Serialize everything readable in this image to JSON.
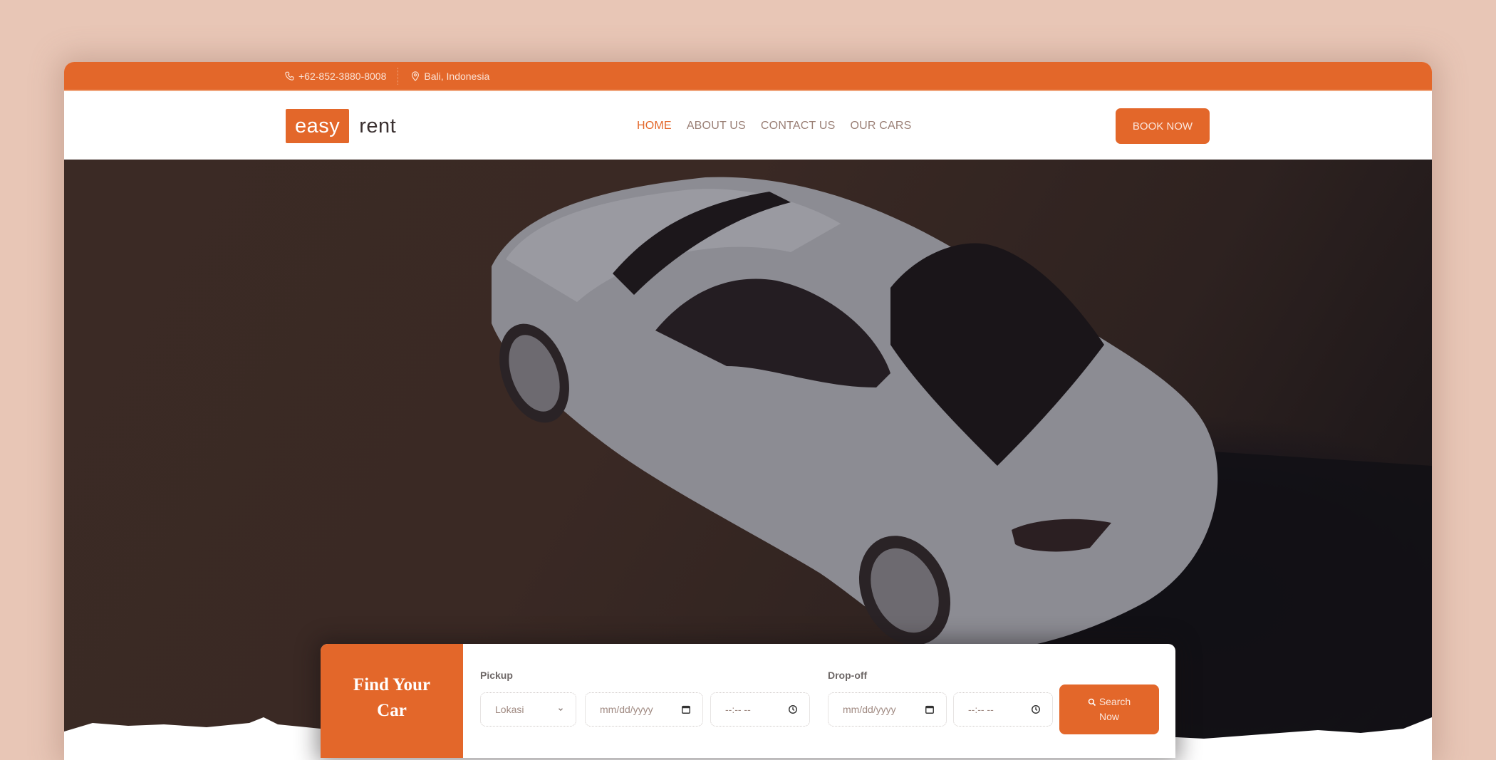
{
  "topbar": {
    "phone": "+62-852-3880-8008",
    "location": "Bali, Indonesia",
    "icons": {
      "phone": "phone-icon",
      "location": "map-pin-icon"
    }
  },
  "brand": {
    "part1": "easy",
    "part2": "rent"
  },
  "nav": {
    "items": [
      {
        "label": "HOME",
        "active": true
      },
      {
        "label": "ABOUT US",
        "active": false
      },
      {
        "label": "CONTACT US",
        "active": false
      },
      {
        "label": "OUR CARS",
        "active": false
      }
    ],
    "cta": "BOOK NOW"
  },
  "hero": {
    "image": "white sports car top view on asphalt"
  },
  "finder": {
    "title_line1": "Find Your",
    "title_line2": "Car",
    "pickup": {
      "label": "Pickup",
      "location_placeholder": "Lokasi",
      "date_placeholder": "mm/dd/yyyy",
      "time_placeholder": "--:-- --"
    },
    "dropoff": {
      "label": "Drop-off",
      "date_placeholder": "mm/dd/yyyy",
      "time_placeholder": "--:-- --"
    },
    "search_line1": "Search",
    "search_line2": "Now"
  },
  "colors": {
    "accent": "#e3672a",
    "page_bg": "#e8c6b6",
    "nav_text": "#9a7f75"
  }
}
